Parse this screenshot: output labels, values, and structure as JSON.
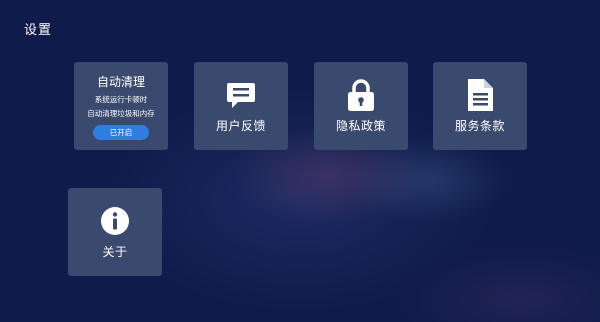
{
  "header": {
    "title": "设置"
  },
  "tiles": {
    "auto_clean": {
      "title": "自动清理",
      "line1": "系统运行卡顿时",
      "line2": "自动清理垃圾和内存",
      "toggle_label": "已开启"
    },
    "feedback": {
      "label": "用户反馈",
      "icon": "chat-message-icon"
    },
    "privacy": {
      "label": "隐私政策",
      "icon": "lock-icon"
    },
    "terms": {
      "label": "服务条款",
      "icon": "document-icon"
    },
    "about": {
      "label": "关于",
      "icon": "info-icon"
    }
  },
  "colors": {
    "background": "#0f1b4a",
    "tile": "#3a4a6e",
    "accent": "#2e7fe0"
  }
}
